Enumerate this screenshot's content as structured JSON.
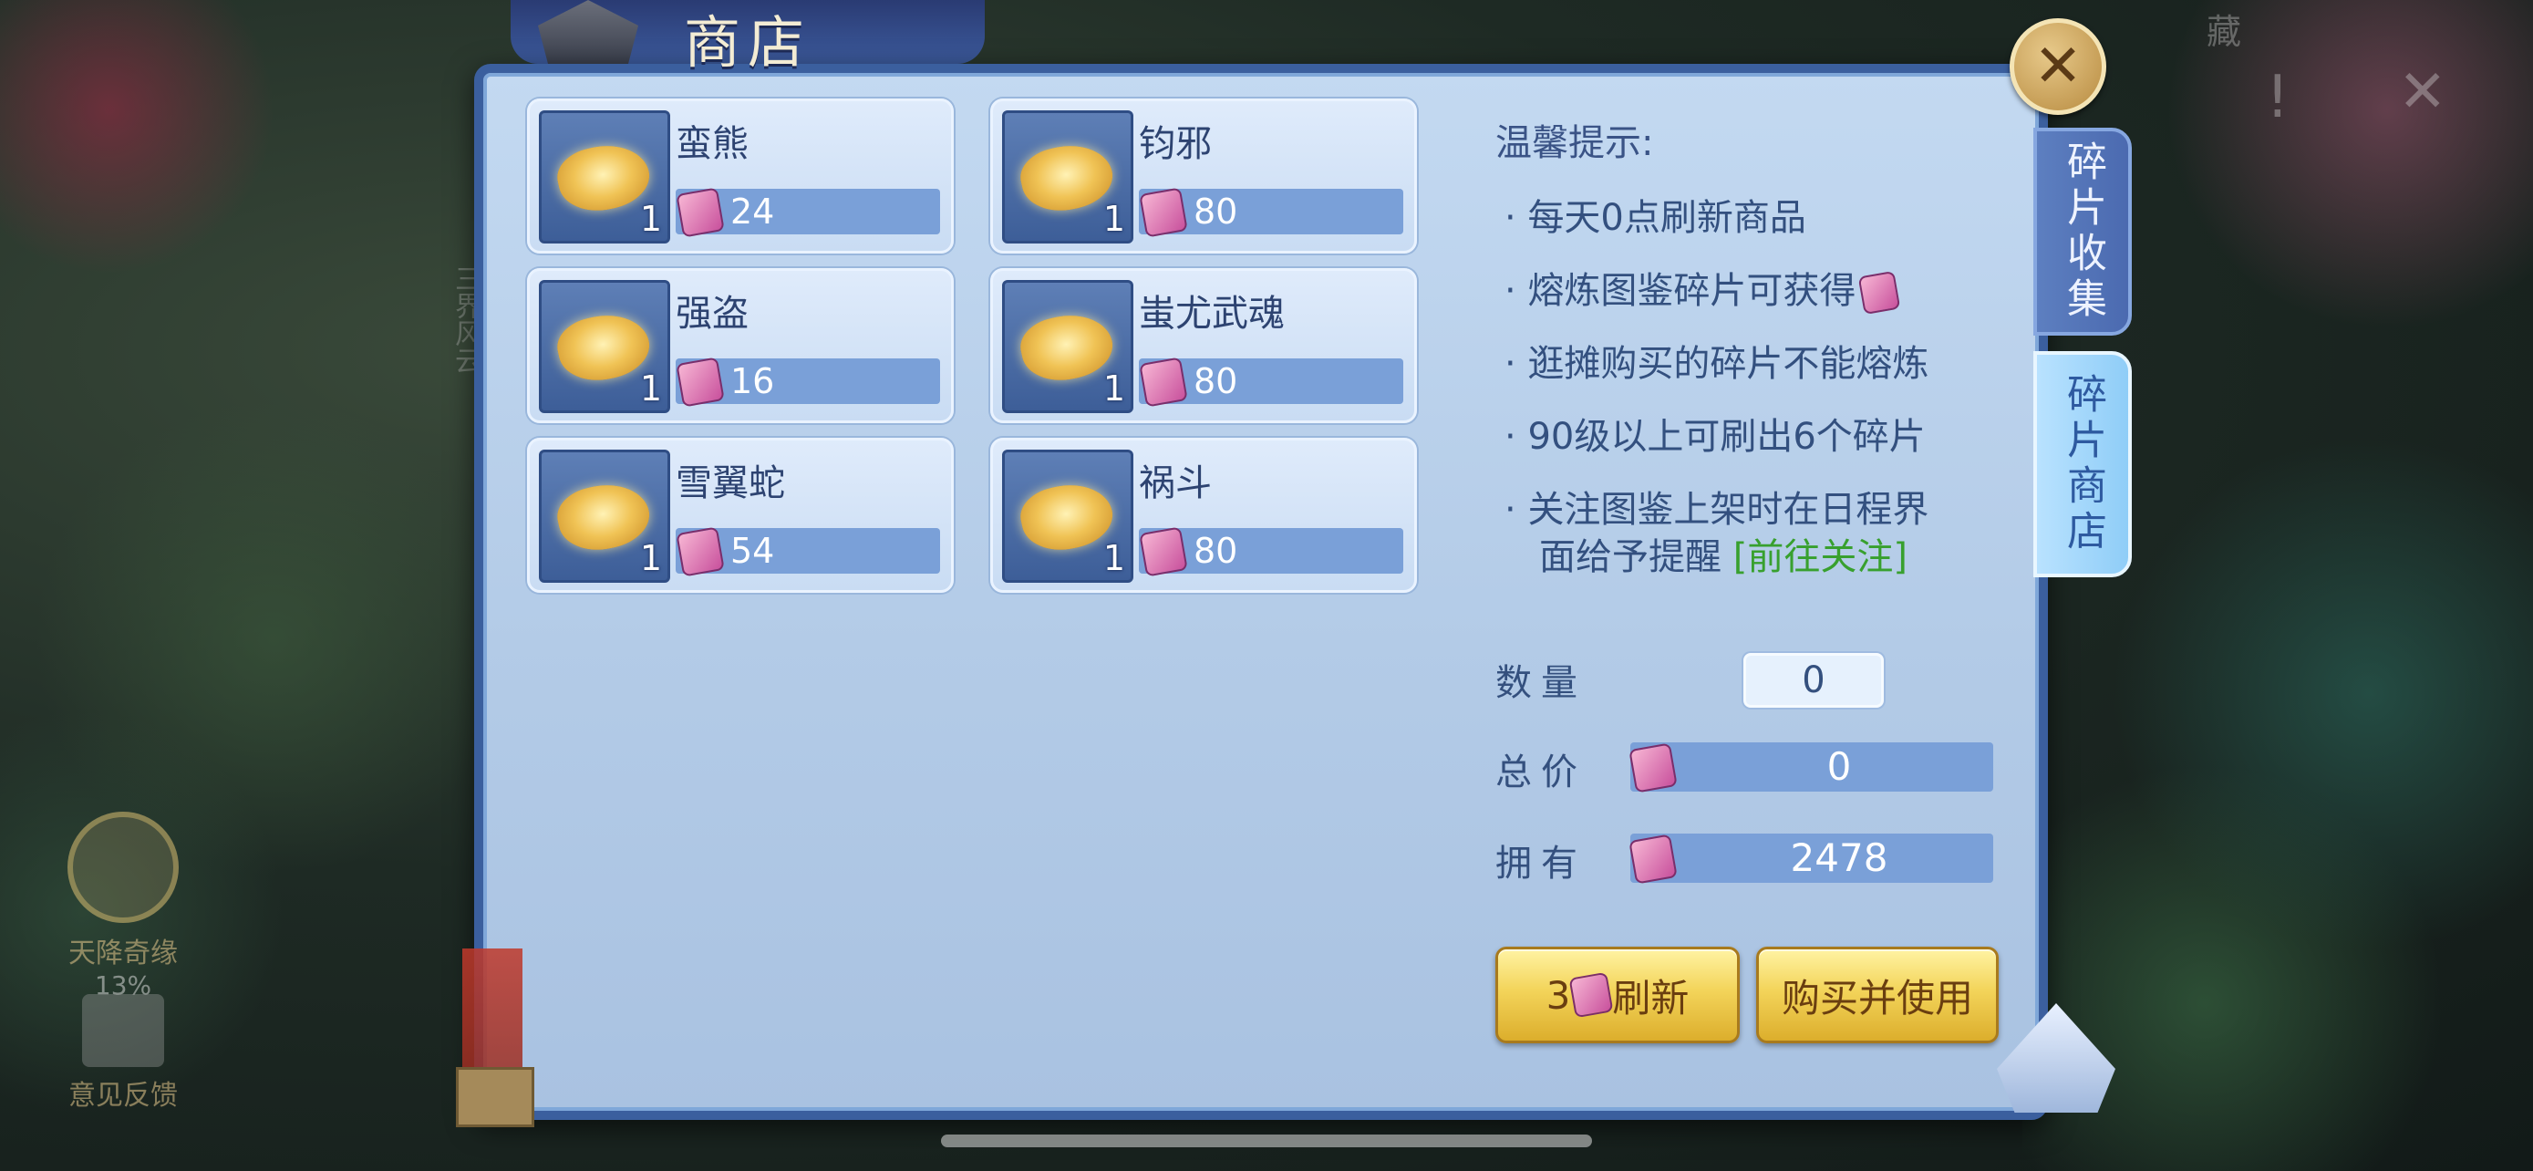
{
  "title": "商店",
  "tabs": [
    {
      "label": "碎片收集",
      "active": false
    },
    {
      "label": "碎片商店",
      "active": true
    }
  ],
  "items": [
    {
      "name": "蛮熊",
      "qty": "1",
      "price": "24"
    },
    {
      "name": "钧邪",
      "qty": "1",
      "price": "80"
    },
    {
      "name": "强盗",
      "qty": "1",
      "price": "16"
    },
    {
      "name": "蚩尤武魂",
      "qty": "1",
      "price": "80"
    },
    {
      "name": "雪翼蛇",
      "qty": "1",
      "price": "54"
    },
    {
      "name": "祸斗",
      "qty": "1",
      "price": "80"
    }
  ],
  "tips": {
    "title": "温馨提示:",
    "lines": [
      "每天0点刷新商品",
      "熔炼图鉴碎片可获得",
      "逛摊购买的碎片不能熔炼",
      "90级以上可刷出6个碎片",
      "关注图鉴上架时在日程界",
      "面给予提醒"
    ],
    "link": "[前往关注]"
  },
  "form": {
    "quantity_label": "数量",
    "quantity_value": "0",
    "total_label": "总价",
    "total_value": "0",
    "owned_label": "拥有",
    "owned_value": "2478"
  },
  "buttons": {
    "refresh_cost": "3",
    "refresh_label": "刷新",
    "buy_label": "购买并使用"
  },
  "background": {
    "side_text": "三界风云",
    "event_label": "天降奇缘",
    "event_progress": "13%",
    "feedback_label": "意见反馈",
    "top_right_glyph": "藏"
  },
  "icons": {
    "currency": "fragment-coin-icon",
    "item": "golden-scroll-fragment-icon",
    "close": "close-x-icon"
  },
  "colors": {
    "panel_border": "#3b5f9e",
    "price_bar": "#7aa0d8",
    "button_gold": "#f3d45a",
    "link_green": "#38a02e",
    "active_tab": "#8fcdf7"
  }
}
